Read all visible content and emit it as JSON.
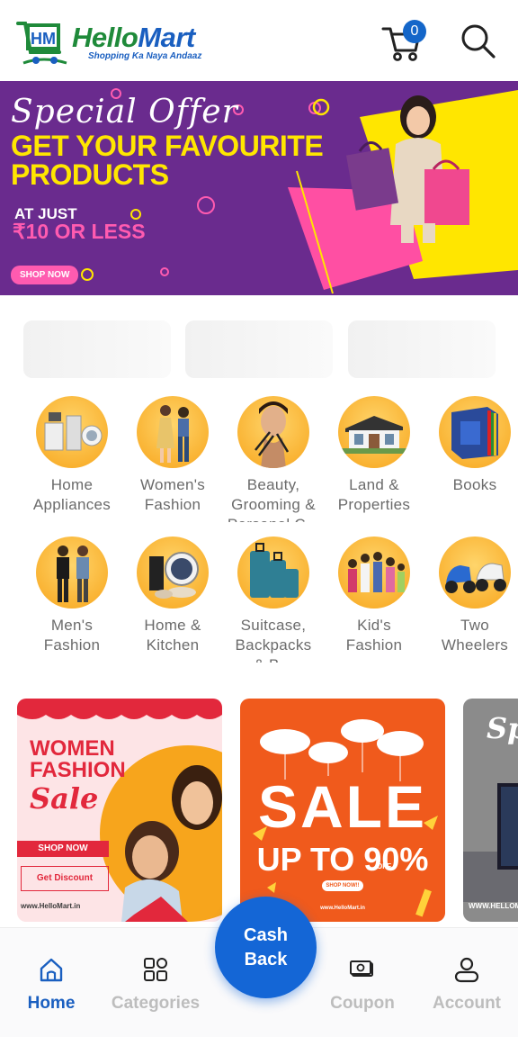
{
  "header": {
    "brand_part1": "Hello",
    "brand_part2": "Mart",
    "tagline": "Shopping Ka Naya Andaaz",
    "logo_letters": "HM",
    "cart_count": "0",
    "cart_icon": "cart-icon",
    "search_icon": "search-icon"
  },
  "banner": {
    "script": "Special Offer",
    "headline_line1": "GET YOUR FAVOURITE",
    "headline_line2": "PRODUCTS",
    "at_just": "AT JUST",
    "price": "₹10 OR LESS",
    "cta": "SHOP NOW"
  },
  "categories": [
    {
      "label_line1": "Home",
      "label_line2": "Appliances"
    },
    {
      "label_line1": "Women's",
      "label_line2": "Fashion"
    },
    {
      "label_line1": "Beauty,",
      "label_line2": "Grooming &",
      "label_line3": "Personal C..."
    },
    {
      "label_line1": "Land &",
      "label_line2": "Properties"
    },
    {
      "label_line1": "Books",
      "label_line2": ""
    },
    {
      "label_line1": "Men's",
      "label_line2": "Fashion"
    },
    {
      "label_line1": "Home &",
      "label_line2": "Kitchen"
    },
    {
      "label_line1": "Suitcase,",
      "label_line2": "Backpacks",
      "label_line3": "& B..."
    },
    {
      "label_line1": "Kid's",
      "label_line2": "Fashion"
    },
    {
      "label_line1": "Two",
      "label_line2": "Wheelers"
    }
  ],
  "promos": {
    "women": {
      "line1": "WOMEN",
      "line2": "FASHION",
      "sale": "Sale",
      "shop_now": "SHOP NOW",
      "discount": "Get Discount",
      "url": "www.HelloMart.in"
    },
    "sale": {
      "sale": "SALE",
      "up_to": "UP TO 90%",
      "off": "OFF",
      "shop_now": "SHOP NOW!!",
      "url": "www.HelloMart.in"
    },
    "third": {
      "title": "Sp",
      "url": "WWW.HELLOMART.IN"
    }
  },
  "bottom_nav": {
    "home": "Home",
    "categories": "Categories",
    "cashback_line1": "Cash",
    "cashback_line2": "Back",
    "coupon": "Coupon",
    "account": "Account",
    "active": "Home",
    "active_color": "#1a5fc0",
    "inactive_color": "#bdbdbd"
  },
  "colors": {
    "brand_green": "#1f8a3a",
    "brand_blue": "#1a5fc0",
    "banner_purple": "#6a2b8e",
    "banner_yellow": "#ffe600",
    "banner_pink": "#ff5bb0",
    "category_circle": "#f7a51c",
    "cashback": "#1466d6"
  }
}
